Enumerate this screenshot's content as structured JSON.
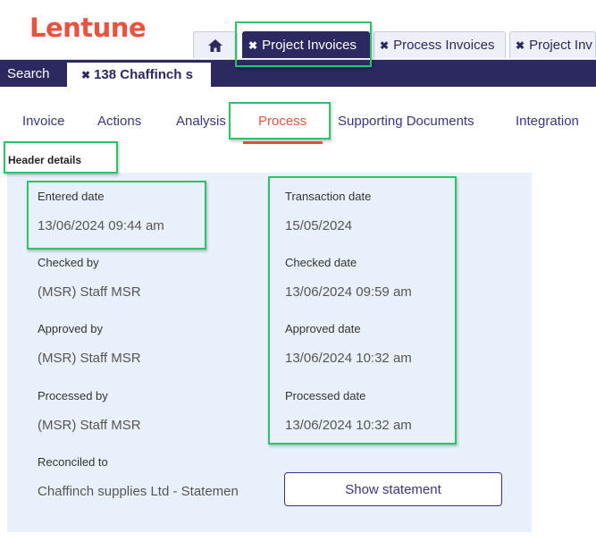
{
  "app": {
    "logo": "Lentune"
  },
  "tabs": {
    "home_icon": "home-icon",
    "items": [
      {
        "label": "Project Invoices",
        "active": true
      },
      {
        "label": "Process Invoices",
        "active": false
      },
      {
        "label": "Project Inv",
        "active": false
      }
    ]
  },
  "subbar": {
    "search": "Search",
    "document_tab": "138 Chaffinch s"
  },
  "nav": {
    "items": [
      {
        "label": "Invoice"
      },
      {
        "label": "Actions"
      },
      {
        "label": "Analysis"
      },
      {
        "label": "Process",
        "active": true
      },
      {
        "label": "Supporting Documents"
      },
      {
        "label": "Integration"
      }
    ]
  },
  "section": {
    "title": "Header details"
  },
  "fields": {
    "entered_date": {
      "label": "Entered date",
      "value": "13/06/2024 09:44 am"
    },
    "transaction_date": {
      "label": "Transaction date",
      "value": "15/05/2024"
    },
    "checked_by": {
      "label": "Checked by",
      "value": "(MSR) Staff MSR"
    },
    "checked_date": {
      "label": "Checked date",
      "value": "13/06/2024 09:59 am"
    },
    "approved_by": {
      "label": "Approved by",
      "value": "(MSR) Staff MSR"
    },
    "approved_date": {
      "label": "Approved date",
      "value": "13/06/2024 10:32 am"
    },
    "processed_by": {
      "label": "Processed by",
      "value": "(MSR) Staff MSR"
    },
    "processed_date": {
      "label": "Processed date",
      "value": "13/06/2024 10:32 am"
    },
    "reconciled_to": {
      "label": "Reconciled to",
      "value": "Chaffinch supplies Ltd - Statemen"
    }
  },
  "buttons": {
    "show_statement": "Show statement"
  },
  "colors": {
    "brand": "#e8523f",
    "navy": "#2b2960",
    "highlight": "#2ec26a",
    "panel": "#e8f1fb"
  }
}
